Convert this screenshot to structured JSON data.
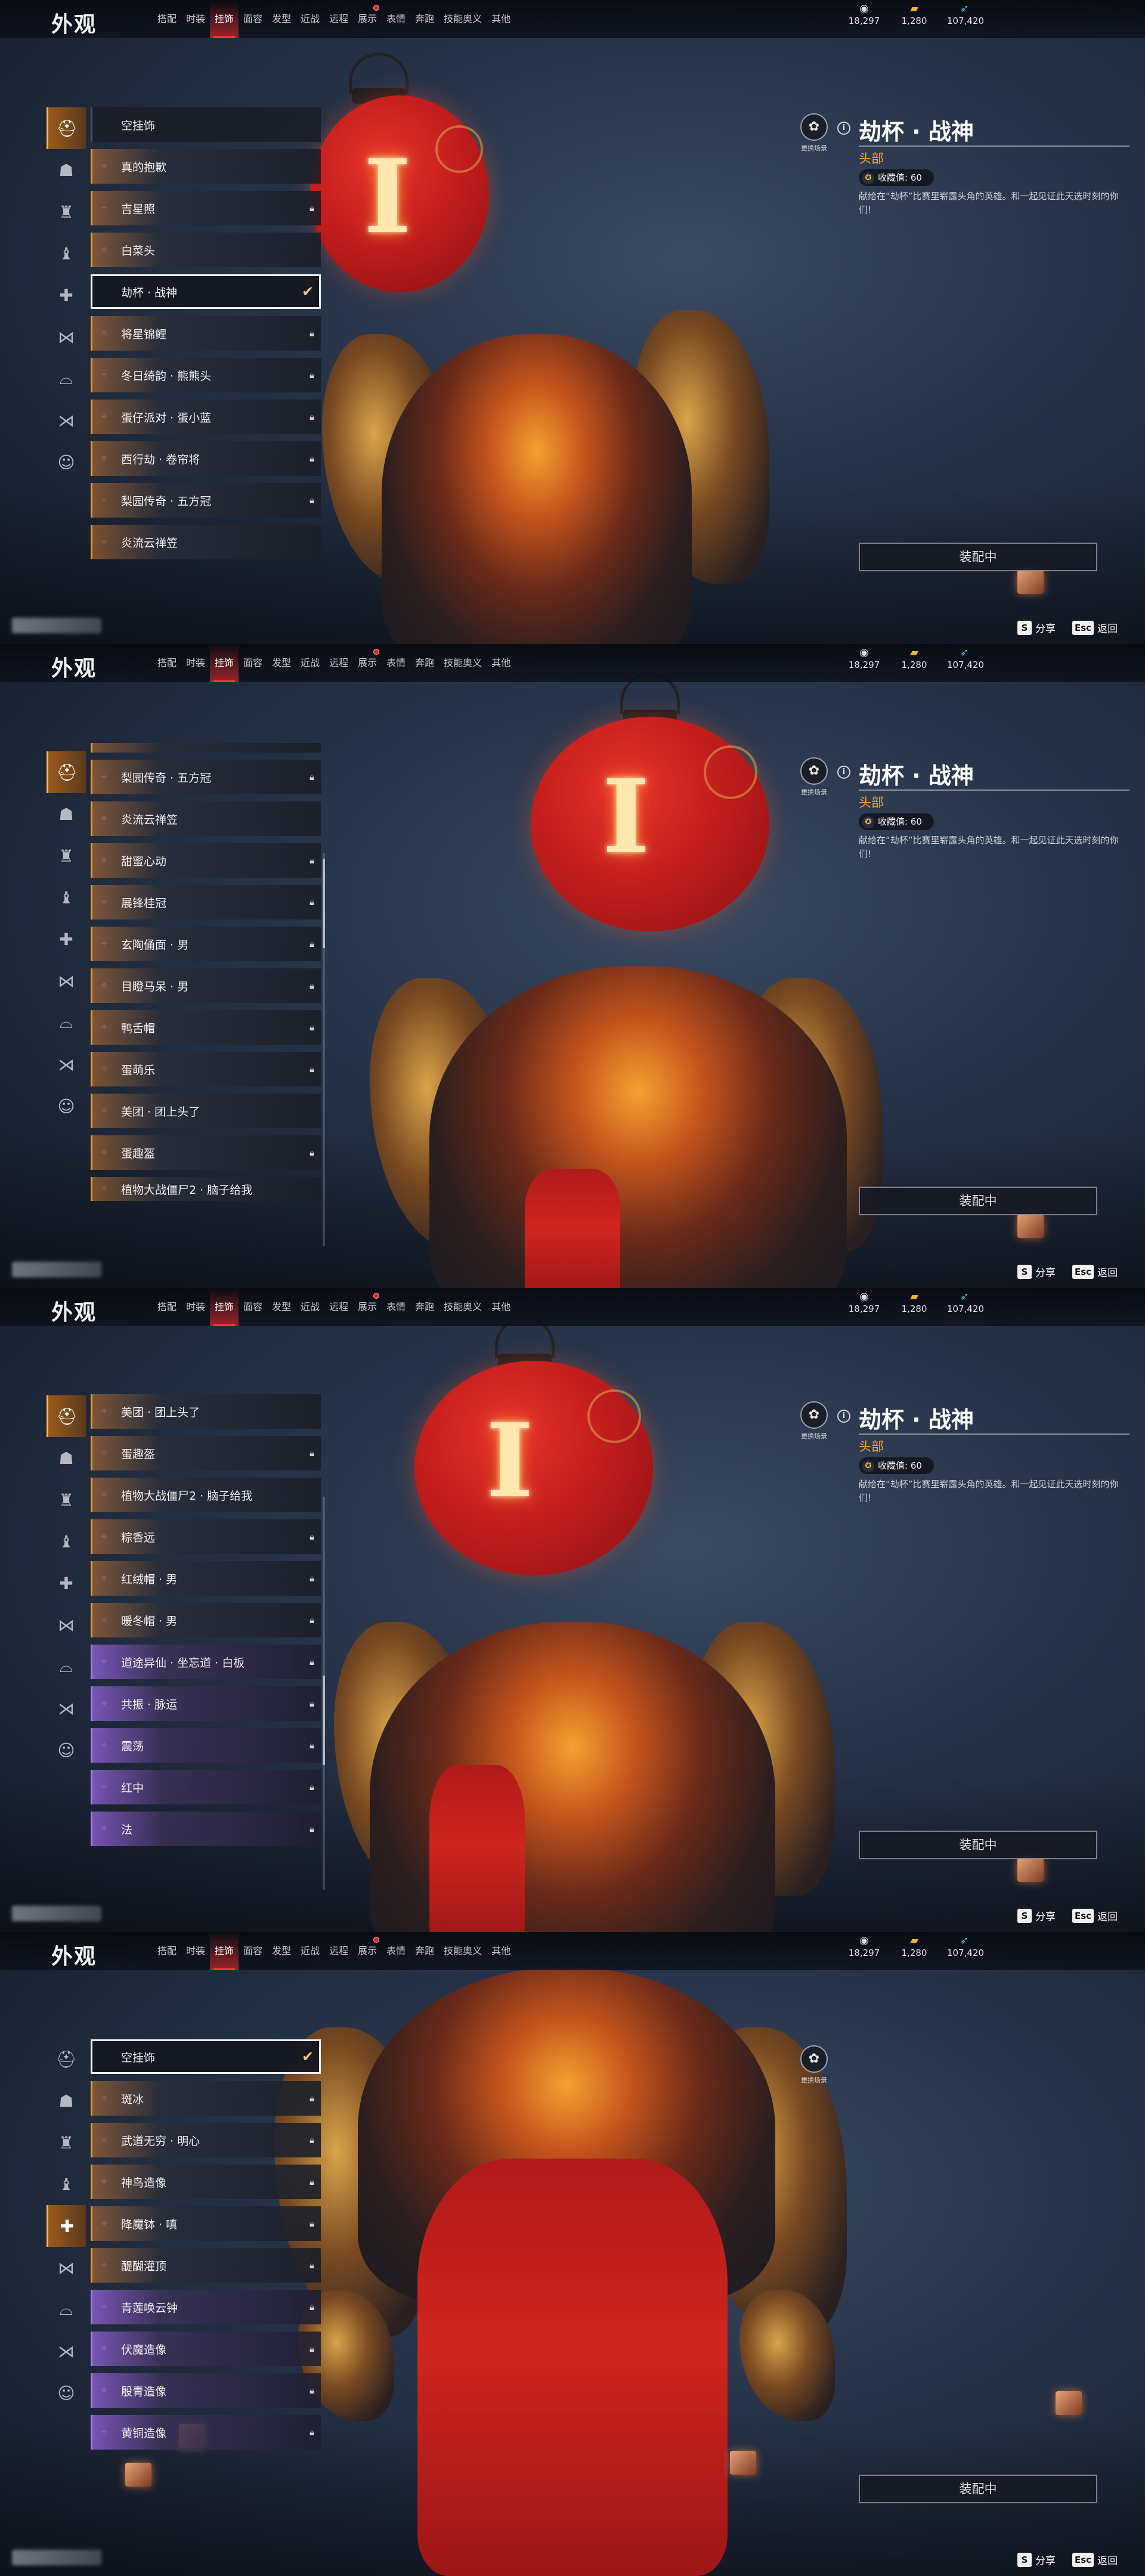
{
  "header": {
    "title": "外观",
    "tabs": [
      {
        "label": "搭配"
      },
      {
        "label": "时装"
      },
      {
        "label": "挂饰"
      },
      {
        "label": "面容"
      },
      {
        "label": "发型"
      },
      {
        "label": "近战"
      },
      {
        "label": "远程"
      },
      {
        "label": "展示"
      },
      {
        "label": "表情"
      },
      {
        "label": "奔跑"
      },
      {
        "label": "技能奥义"
      },
      {
        "label": "其他"
      }
    ],
    "active_tab": "挂饰",
    "currencies": [
      {
        "icon": "eye-icon",
        "value": "18,297"
      },
      {
        "icon": "gold-ingot-icon",
        "value": "1,280"
      },
      {
        "icon": "feather-icon",
        "value": "107,420"
      }
    ]
  },
  "rail_icons": [
    "helmet-icon",
    "mask-icon",
    "shoulder-icon",
    "cape-icon",
    "armor-icon",
    "waist-icon",
    "bracer-icon",
    "bow-icon",
    "face-icon"
  ],
  "detail": {
    "swap_label": "更换场景",
    "item_name": "劫杯 · 战神",
    "slot": "头部",
    "rating": "收藏值: 60",
    "description": "献给在“劫杯”比赛里崭露头角的英雄。和一起见证此天选时刻的你们!"
  },
  "equip_button": "装配中",
  "footer": {
    "share_key": "S",
    "share": "分享",
    "back_key": "Esc",
    "back": "返回"
  },
  "panels": [
    {
      "items": [
        {
          "label": "空挂饰",
          "style": "plain"
        },
        {
          "label": "真的抱歉",
          "style": "orange"
        },
        {
          "label": "吉星照",
          "style": "orange",
          "locked": true
        },
        {
          "label": "白菜头",
          "style": "orange"
        },
        {
          "label": "劫杯 · 战神",
          "style": "selected",
          "checked": true
        },
        {
          "label": "将星锦鲤",
          "style": "orange",
          "locked": true
        },
        {
          "label": "冬日绮韵 · 熊熊头",
          "style": "orange",
          "locked": true
        },
        {
          "label": "蛋仔派对 · 蛋小蓝",
          "style": "orange",
          "locked": true
        },
        {
          "label": "西行劫 · 卷帘将",
          "style": "orange",
          "locked": true
        },
        {
          "label": "梨园传奇 · 五方冠",
          "style": "orange",
          "locked": true
        },
        {
          "label": "炎流云禅笠",
          "style": "orange"
        }
      ]
    },
    {
      "items": [
        {
          "label": "",
          "style": "orange"
        },
        {
          "label": "梨园传奇 · 五方冠",
          "style": "orange",
          "locked": true
        },
        {
          "label": "炎流云禅笠",
          "style": "orange"
        },
        {
          "label": "甜蜜心动",
          "style": "orange",
          "locked": true
        },
        {
          "label": "展锋桂冠",
          "style": "orange",
          "locked": true
        },
        {
          "label": "玄陶俑面 · 男",
          "style": "orange",
          "locked": true
        },
        {
          "label": "目瞪马呆 · 男",
          "style": "orange",
          "locked": true
        },
        {
          "label": "鸭舌帽",
          "style": "orange",
          "locked": true
        },
        {
          "label": "蛋萌乐",
          "style": "orange",
          "locked": true
        },
        {
          "label": "美团 · 团上头了",
          "style": "orange"
        },
        {
          "label": "蛋趣盔",
          "style": "orange",
          "locked": true
        },
        {
          "label": "植物大战僵尸2 · 脑子给我",
          "style": "orange"
        }
      ]
    },
    {
      "items": [
        {
          "label": "美团 · 团上头了",
          "style": "orange"
        },
        {
          "label": "蛋趣盔",
          "style": "orange",
          "locked": true
        },
        {
          "label": "植物大战僵尸2 · 脑子给我",
          "style": "orange"
        },
        {
          "label": "粽香远",
          "style": "orange",
          "locked": true
        },
        {
          "label": "红绒帽 · 男",
          "style": "orange",
          "locked": true
        },
        {
          "label": "暖冬帽 · 男",
          "style": "orange",
          "locked": true
        },
        {
          "label": "道途异仙 · 坐忘道 · 白板",
          "style": "purple",
          "locked": true
        },
        {
          "label": "共振 · 脉运",
          "style": "purple",
          "locked": true
        },
        {
          "label": "震荡",
          "style": "purple",
          "locked": true
        },
        {
          "label": "红中",
          "style": "purple",
          "locked": true
        },
        {
          "label": "法",
          "style": "purple",
          "locked": true
        }
      ]
    },
    {
      "items": [
        {
          "label": "空挂饰",
          "style": "selected",
          "checked": true
        },
        {
          "label": "斑冰",
          "style": "orange",
          "locked": true
        },
        {
          "label": "武道无穷 · 明心",
          "style": "orange",
          "locked": true
        },
        {
          "label": "神鸟造像",
          "style": "orange",
          "locked": true
        },
        {
          "label": "降魔钵 · 嗔",
          "style": "orange",
          "locked": true
        },
        {
          "label": "醍醐灌顶",
          "style": "orange",
          "locked": true
        },
        {
          "label": "青莲唤云钟",
          "style": "purple",
          "locked": true
        },
        {
          "label": "伏魔造像",
          "style": "purple",
          "locked": true
        },
        {
          "label": "殷青造像",
          "style": "purple",
          "locked": true
        },
        {
          "label": "黄铜造像",
          "style": "purple",
          "locked": true
        }
      ]
    }
  ]
}
